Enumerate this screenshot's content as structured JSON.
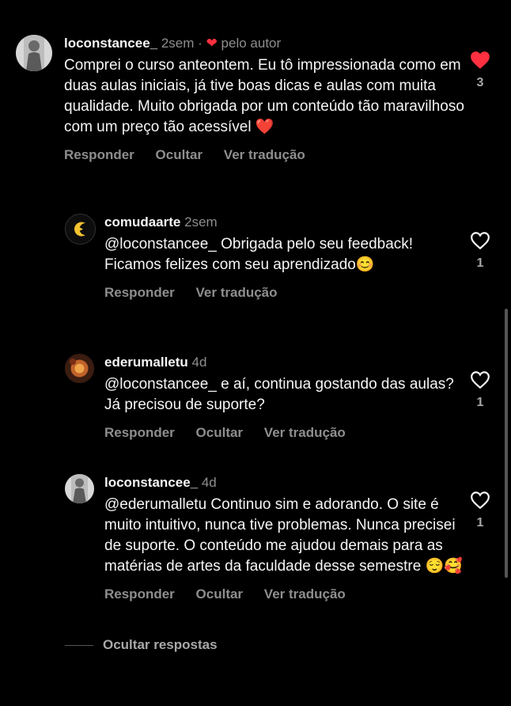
{
  "comments": [
    {
      "username": "loconstancee_",
      "time": "2sem",
      "separator": "·",
      "by_author_label": "pelo autor",
      "text": "Comprei o curso anteontem. Eu tô impressionada como em duas aulas iniciais, já tive boas dicas e aulas com muita qualidade. Muito obrigada por um conteúdo tão maravilhoso com um preço tão acessível ❤️",
      "actions": [
        "Responder",
        "Ocultar",
        "Ver tradução"
      ],
      "likes": "3",
      "liked": true
    },
    {
      "username": "comudaarte",
      "time": "2sem",
      "text": "@loconstancee_ Obrigada pelo seu feedback! Ficamos felizes com seu aprendizado😊",
      "actions": [
        "Responder",
        "Ver tradução"
      ],
      "likes": "1",
      "liked": false
    },
    {
      "username": "ederumalletu",
      "time": "4d",
      "text": "@loconstancee_ e aí, continua gostando das aulas? Já precisou de suporte?",
      "actions": [
        "Responder",
        "Ocultar",
        "Ver tradução"
      ],
      "likes": "1",
      "liked": false
    },
    {
      "username": "loconstancee_",
      "time": "4d",
      "text": "@ederumalletu Continuo sim e adorando. O site é muito intuitivo, nunca tive problemas. Nunca precisei de suporte. O conteúdo me ajudou demais para as matérias de artes da faculdade desse semestre 😌🥰",
      "actions": [
        "Responder",
        "Ocultar",
        "Ver tradução"
      ],
      "likes": "1",
      "liked": false
    }
  ],
  "hide_replies_label": "Ocultar respostas",
  "colors": {
    "like_red": "#ff3040",
    "muted": "#8e8e8e",
    "text": "#f5f5f5",
    "background": "#000000"
  }
}
